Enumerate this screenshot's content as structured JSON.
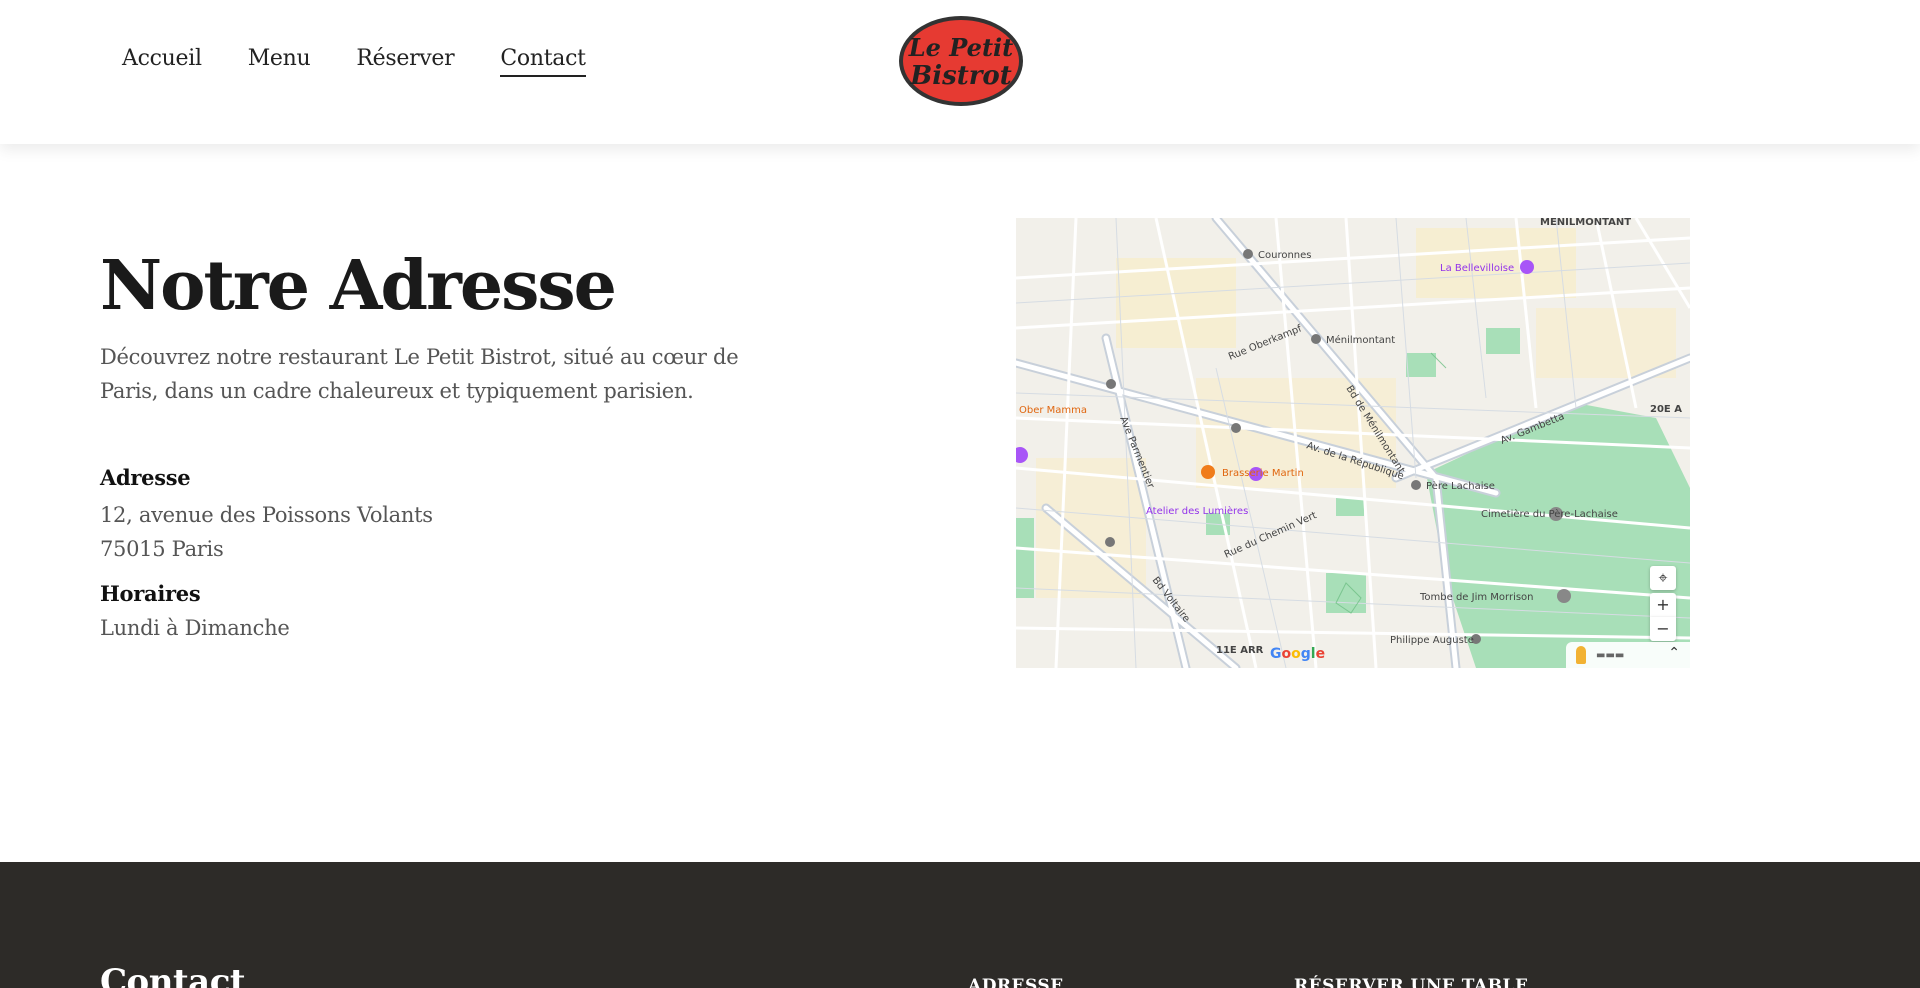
{
  "header": {
    "nav": [
      {
        "label": "Accueil"
      },
      {
        "label": "Menu"
      },
      {
        "label": "Réserver"
      },
      {
        "label": "Contact",
        "active": true
      }
    ],
    "logo_text": [
      "Le Petit",
      "Bistrot"
    ],
    "logo_color": "#e63a32"
  },
  "main": {
    "title": "Notre Adresse",
    "intro": "Découvrez notre restaurant Le Petit Bistrot, situé au cœur de Paris, dans un cadre chaleureux et typiquement parisien.",
    "address_label": "Adresse",
    "address_line1": "12, avenue des Poissons Volants",
    "address_line2": "75015 Paris",
    "hours_label": "Horaires",
    "hours_value": "Lundi à Dimanche"
  },
  "map": {
    "labels": {
      "menilmontant_top": "MENILMONTANT",
      "couronnes": "Couronnes",
      "la_bellevilloise": "La Bellevilloise",
      "menilmontant": "Ménilmontant",
      "rue_oberkampf": "Rue Oberkampf",
      "ober_mamma": "Ober Mamma",
      "brasserie_martin": "Brasserie Martin",
      "atelier_lumieres": "Atelier des Lumières",
      "pere_lachaise": "Père Lachaise",
      "cimetiere": "Cimetière du Père-Lachaise",
      "jim_morrison": "Tombe de Jim Morrison",
      "philippe_auguste": "Philippe Auguste",
      "av_republique": "Av. de la République",
      "av_gambetta": "Av. Gambetta",
      "bd_menilmontant": "Bd de Ménilmontant",
      "rue_chemin_vert": "Rue du Chemin Vert",
      "ave_parmentier": "Ave Parmentier",
      "bd_voltaire": "Bd Voltaire",
      "arr11": "11E ARR",
      "arr20": "20E A",
      "google": "Google"
    },
    "controls": {
      "locate": "⌖",
      "zoom_in": "+",
      "zoom_out": "−",
      "collapse": "⌃"
    }
  },
  "footer": {
    "title": "Contact",
    "col1": "Adresse",
    "col2": "Réserver une table"
  }
}
